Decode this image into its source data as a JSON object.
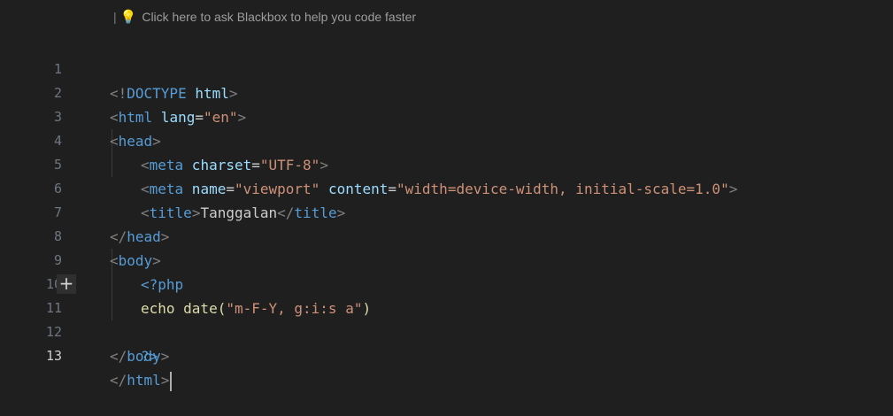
{
  "hint": {
    "text": "Click here to ask Blackbox to help you code faster",
    "icon": "lightbulb-icon"
  },
  "gutter": {
    "line_numbers": [
      "1",
      "2",
      "3",
      "4",
      "5",
      "6",
      "7",
      "8",
      "9",
      "10",
      "11",
      "12",
      "13"
    ],
    "current_line": "13",
    "add_icon": "plus-icon"
  },
  "code": {
    "l1": {
      "open": "<!",
      "doctype": "DOCTYPE",
      "sp": " ",
      "kw": "html",
      "close": ">"
    },
    "l2": {
      "open": "<",
      "tag": "html",
      "attr": " lang",
      "eq": "=",
      "val": "\"en\"",
      "close": ">"
    },
    "l3": {
      "open": "<",
      "tag": "head",
      "close": ">"
    },
    "l4": {
      "open": "<",
      "tag": "meta",
      "attr": " charset",
      "eq": "=",
      "val": "\"UTF-8\"",
      "close": ">"
    },
    "l5": {
      "open": "<",
      "tag": "meta",
      "attr1": " name",
      "eq1": "=",
      "val1": "\"viewport\"",
      "attr2": " content",
      "eq2": "=",
      "val2": "\"width=device-width, initial-scale=1.0\"",
      "close": ">"
    },
    "l6": {
      "open": "<",
      "tag": "title",
      "close": ">",
      "text": "Tanggalan",
      "end_open": "</",
      "end_tag": "title",
      "end_close": ">"
    },
    "l7": {
      "open": "</",
      "tag": "head",
      "close": ">"
    },
    "l8": {
      "open": "<",
      "tag": "body",
      "close": ">"
    },
    "l9": {
      "php_open": "<?php"
    },
    "l10": {
      "fn": "echo",
      "rest": " date(",
      "str": "\"m-F-Y, g:i:s a\"",
      "end": ")"
    },
    "l11": {
      "php_close": "?>"
    },
    "l12": {
      "open": "</",
      "tag": "body",
      "close": ">"
    },
    "l13": {
      "open": "</",
      "tag": "html",
      "close": ">"
    }
  }
}
